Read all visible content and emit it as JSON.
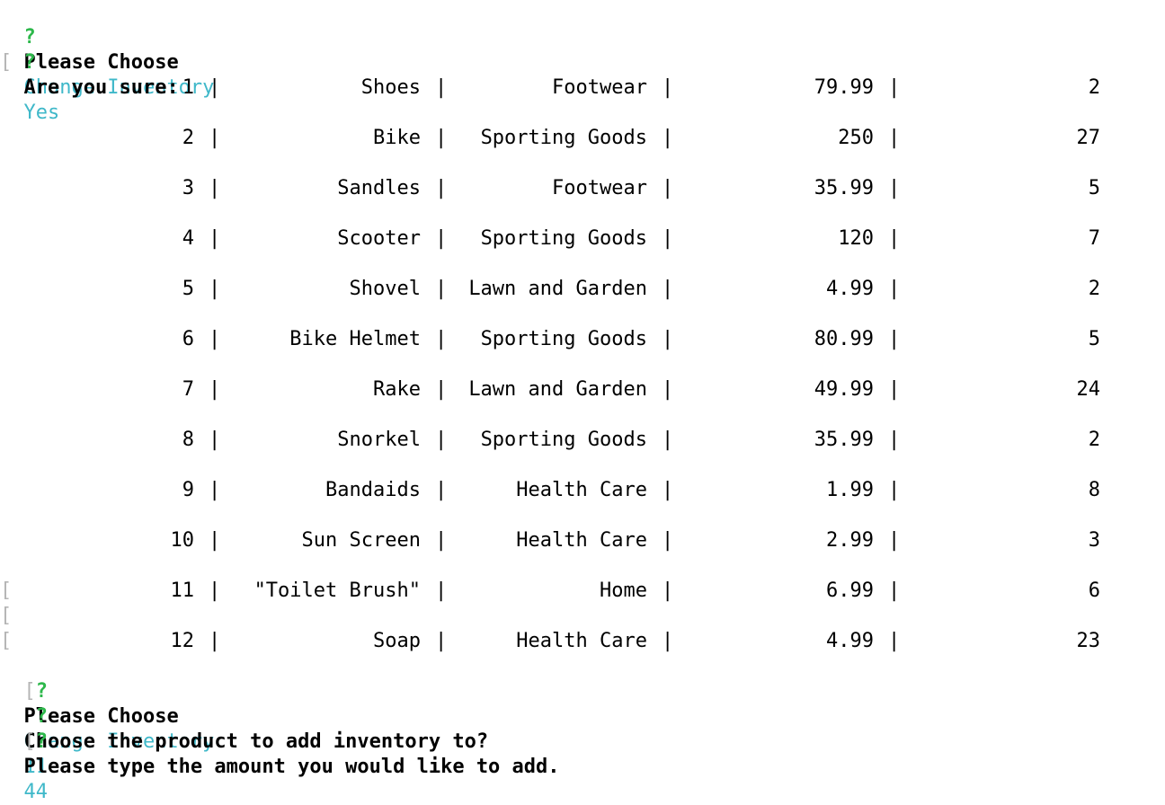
{
  "prompts_top": [
    {
      "mark": "?",
      "question": "Please Choose",
      "answer": "Change Inventory"
    },
    {
      "mark": "?",
      "question": "Are you sure:",
      "answer": "Yes"
    }
  ],
  "separator": "|",
  "table": {
    "rows": [
      {
        "id": "1",
        "name": "Shoes",
        "department": "Footwear",
        "price": "79.99",
        "quantity": "2"
      },
      {
        "id": "2",
        "name": "Bike",
        "department": "Sporting Goods",
        "price": "250",
        "quantity": "27"
      },
      {
        "id": "3",
        "name": "Sandles",
        "department": "Footwear",
        "price": "35.99",
        "quantity": "5"
      },
      {
        "id": "4",
        "name": "Scooter",
        "department": "Sporting Goods",
        "price": "120",
        "quantity": "7"
      },
      {
        "id": "5",
        "name": "Shovel",
        "department": "Lawn and Garden",
        "price": "4.99",
        "quantity": "2"
      },
      {
        "id": "6",
        "name": "Bike Helmet",
        "department": "Sporting Goods",
        "price": "80.99",
        "quantity": "5"
      },
      {
        "id": "7",
        "name": "Rake",
        "department": "Lawn and Garden",
        "price": "49.99",
        "quantity": "24"
      },
      {
        "id": "8",
        "name": "Snorkel",
        "department": "Sporting Goods",
        "price": "35.99",
        "quantity": "2"
      },
      {
        "id": "9",
        "name": "Bandaids",
        "department": "Health Care",
        "price": "1.99",
        "quantity": "8"
      },
      {
        "id": "10",
        "name": "Sun Screen",
        "department": "Health Care",
        "price": "2.99",
        "quantity": "3"
      },
      {
        "id": "11",
        "name": "\"Toilet Brush\"",
        "department": "Home",
        "price": "6.99",
        "quantity": "6"
      },
      {
        "id": "12",
        "name": "Soap",
        "department": "Health Care",
        "price": "4.99",
        "quantity": "23"
      }
    ]
  },
  "prompts_bottom": [
    {
      "mark": "?",
      "question": "Please Choose",
      "answer": "Change Inventory"
    },
    {
      "mark": "?",
      "question": "Choose the product to add inventory to?",
      "answer": "11"
    },
    {
      "mark": "?",
      "question": "Please type the amount you would like to add.",
      "answer": "44"
    }
  ],
  "bracket_glyph": "["
}
